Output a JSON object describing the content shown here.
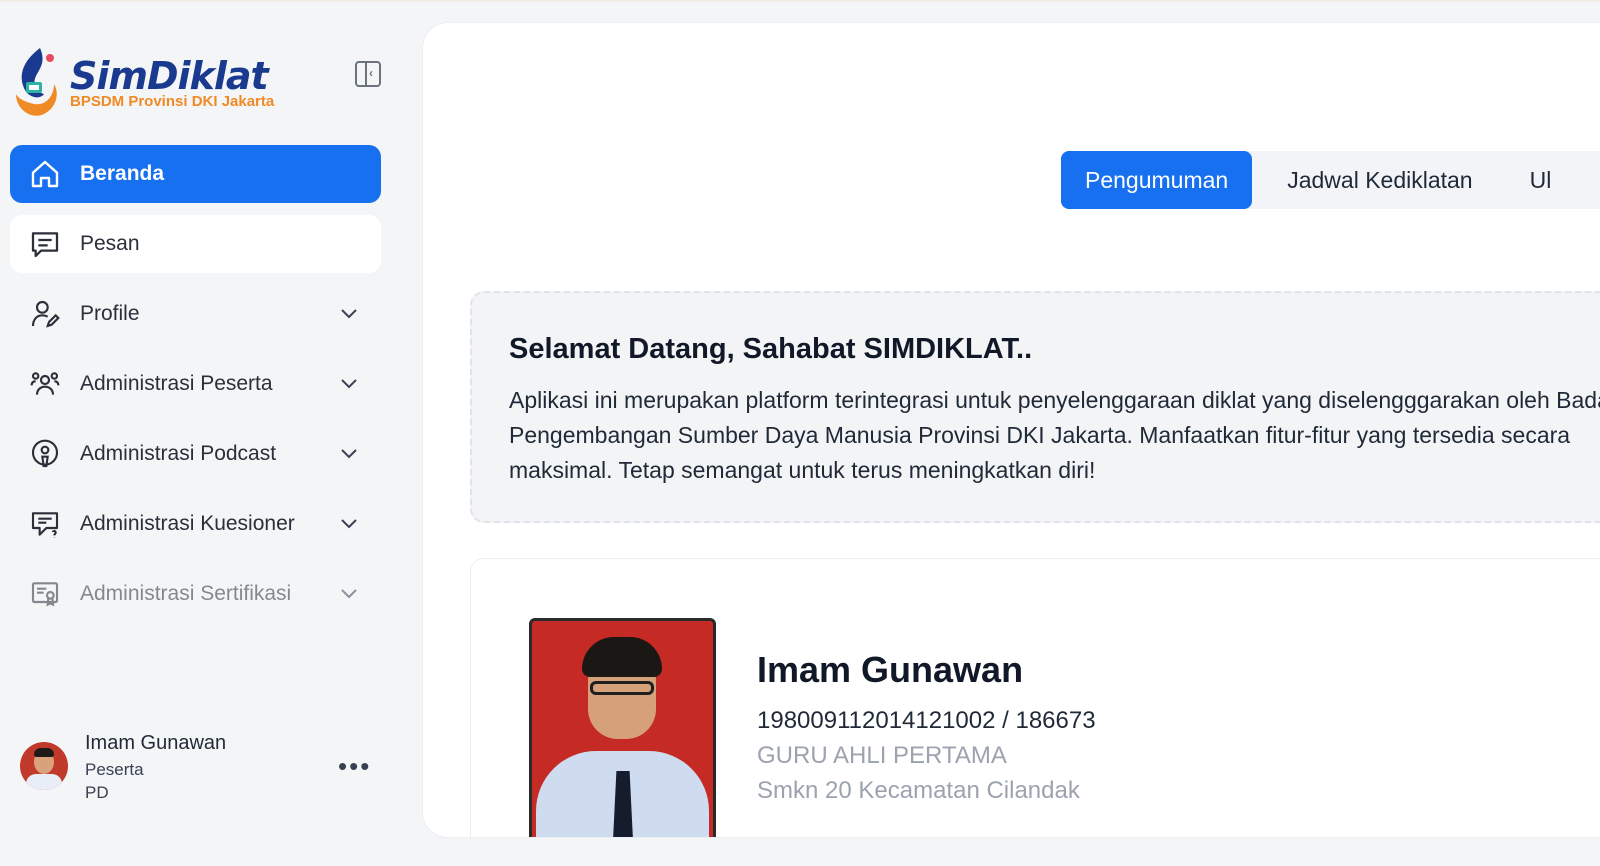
{
  "app": {
    "logo_title": "SimDiklat",
    "logo_subtitle": "BPSDM Provinsi DKI Jakarta"
  },
  "sidebar": {
    "items": [
      {
        "label": "Beranda",
        "icon": "home-icon",
        "active": true
      },
      {
        "label": "Pesan",
        "icon": "message-icon"
      },
      {
        "label": "Profile",
        "icon": "user-edit-icon",
        "expandable": true
      },
      {
        "label": "Administrasi Peserta",
        "icon": "users-group-icon",
        "expandable": true
      },
      {
        "label": "Administrasi Podcast",
        "icon": "podcast-icon",
        "expandable": true
      },
      {
        "label": "Administrasi Kuesioner",
        "icon": "questionnaire-icon",
        "expandable": true
      },
      {
        "label": "Administrasi Sertifikasi",
        "icon": "certificate-icon",
        "expandable": true
      }
    ],
    "user": {
      "name": "Imam Gunawan",
      "role": "Peserta",
      "unit": "PD"
    }
  },
  "main": {
    "tabs": [
      {
        "label": "Pengumuman",
        "active": true
      },
      {
        "label": "Jadwal Kediklatan"
      },
      {
        "label": "Ul"
      }
    ],
    "welcome": {
      "title": "Selamat Datang, Sahabat SIMDIKLAT..",
      "body": "Aplikasi ini merupakan platform terintegrasi untuk penyelenggaraan diklat yang diselengggarakan oleh Badan Pengembangan Sumber Daya Manusia Provinsi DKI Jakarta. Manfaatkan fitur-fitur yang tersedia secara maksimal. Tetap semangat untuk terus meningkatkan diri!"
    },
    "profile": {
      "name": "Imam Gunawan",
      "id": "198009112014121002 / 186673",
      "position": "GURU AHLI PERTAMA",
      "school": "Smkn 20 Kecamatan Cilandak"
    }
  },
  "colors": {
    "accent": "#1670f0",
    "logo_blue": "#1a3a8f",
    "logo_orange": "#f08a24",
    "muted_text": "#9ca3af"
  }
}
